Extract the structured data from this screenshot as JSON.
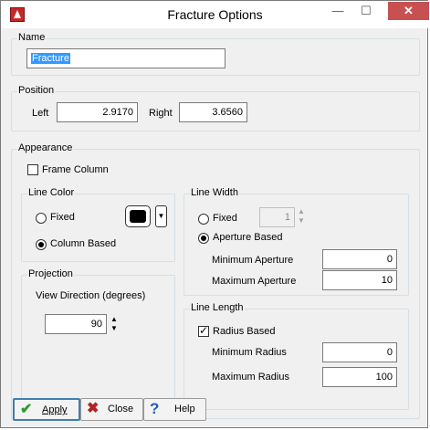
{
  "window": {
    "title": "Fracture Options",
    "min_glyph": "—",
    "max_glyph": "☐",
    "close_glyph": "✕"
  },
  "name_group": {
    "label": "Name",
    "value": "Fracture"
  },
  "position_group": {
    "label": "Position",
    "left_label": "Left",
    "left_value": "2.9170",
    "right_label": "Right",
    "right_value": "3.6560"
  },
  "appearance": {
    "label": "Appearance",
    "frame_column": {
      "label": "Frame Column",
      "checked": false
    },
    "line_color": {
      "label": "Line Color",
      "fixed_label": "Fixed",
      "column_based_label": "Column Based",
      "selected": "Column Based",
      "color": "#000000"
    },
    "line_width": {
      "label": "Line Width",
      "fixed_label": "Fixed",
      "fixed_value": "1",
      "aperture_based_label": "Aperture Based",
      "selected": "Aperture Based",
      "min_aperture_label": "Minimum Aperture",
      "min_aperture_value": "0",
      "max_aperture_label": "Maximum Aperture",
      "max_aperture_value": "10"
    },
    "projection": {
      "label": "Projection",
      "view_direction_label": "View Direction (degrees)",
      "view_direction_value": "90"
    },
    "line_length": {
      "label": "Line Length",
      "radius_based_label": "Radius Based",
      "radius_based_checked": true,
      "min_radius_label": "Minimum Radius",
      "min_radius_value": "0",
      "max_radius_label": "Maximum Radius",
      "max_radius_value": "100"
    }
  },
  "buttons": {
    "apply": "Apply",
    "close": "Close",
    "help": "Help",
    "apply_icon": "✔",
    "close_icon": "✖",
    "help_icon": "?"
  },
  "colors": {
    "apply_icon": "#2e9e2e",
    "close_icon": "#b22222",
    "help_icon": "#1f5fbf",
    "selection": "#3399ff",
    "title_close": "#c75050"
  }
}
